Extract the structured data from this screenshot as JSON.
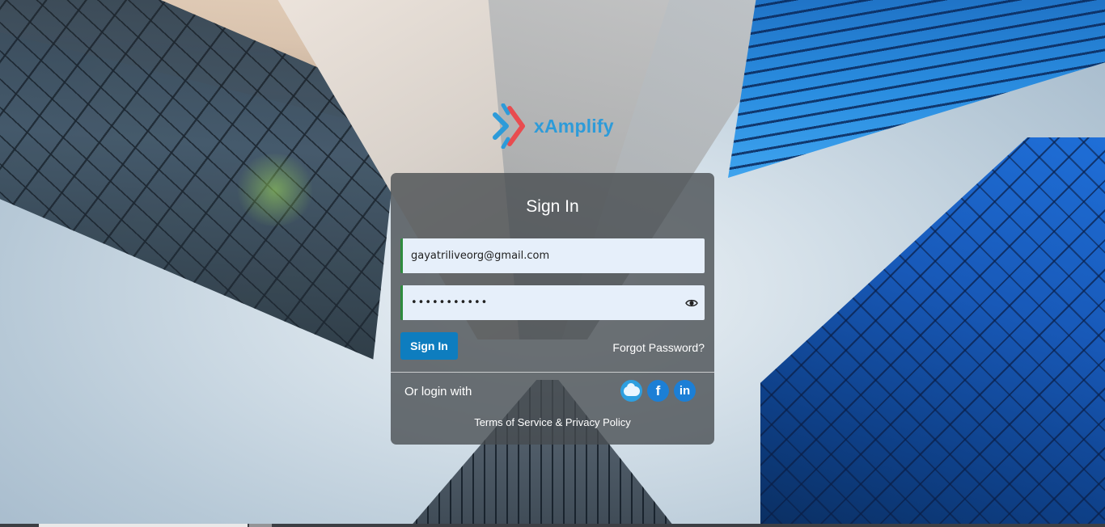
{
  "brand": {
    "name": "xAmplify",
    "colors": {
      "text": "#2d9bd9",
      "mark_left": "#2d9bd9",
      "mark_right": "#e84c4f"
    }
  },
  "signin": {
    "title": "Sign In",
    "email_value": "gayatriliveorg@gmail.com",
    "password_value": "•••••••••••",
    "show_password_icon": "eye-icon",
    "submit_label": "Sign In",
    "forgot_label": "Forgot Password?",
    "or_login_label": "Or login with",
    "social": [
      {
        "name": "salesforce",
        "icon": "salesforce-icon"
      },
      {
        "name": "facebook",
        "icon": "facebook-icon",
        "glyph": "f"
      },
      {
        "name": "linkedin",
        "icon": "linkedin-icon",
        "glyph": "in"
      }
    ],
    "terms_label": "Terms of Service & Privacy Policy",
    "colors": {
      "button": "#0e7dbf",
      "field_bg": "#e6effa",
      "field_accent": "#2e8b3e"
    }
  }
}
